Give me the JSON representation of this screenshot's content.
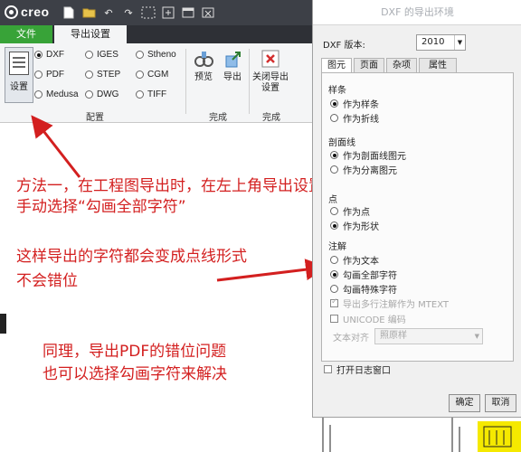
{
  "app": {
    "logo_text": "creo"
  },
  "quick_access": [
    "new-icon",
    "open-icon",
    "undo-icon",
    "redo-icon",
    "select-box-icon",
    "regenerate-icon",
    "window-icon",
    "close-window-icon"
  ],
  "ribbon": {
    "tabs": {
      "file": "文件",
      "export_setup": "导出设置"
    },
    "setup_label": "设置",
    "formats": [
      {
        "label": "DXF",
        "selected": true
      },
      {
        "label": "IGES",
        "selected": false
      },
      {
        "label": "Stheno",
        "selected": false
      },
      {
        "label": "PDF",
        "selected": false
      },
      {
        "label": "STEP",
        "selected": false
      },
      {
        "label": "CGM",
        "selected": false
      },
      {
        "label": "Medusa",
        "selected": false
      },
      {
        "label": "DWG",
        "selected": false
      },
      {
        "label": "TIFF",
        "selected": false
      }
    ],
    "groups": {
      "config": "配置",
      "finish1": "完成",
      "finish2": "完成"
    },
    "preview_label": "预览",
    "export_label": "导出",
    "close_label_1": "关闭导出",
    "close_label_2": "设置"
  },
  "annotations": {
    "line1": "方法一，在工程图导出时，在左上角导出设置",
    "line2": "手动选择“勾画全部字符”",
    "line3": "这样导出的字符都会变成点线形式",
    "line4": "不会错位",
    "line5": "同理，导出PDF的错位问题",
    "line6": "也可以选择勾画字符来解决"
  },
  "dialog": {
    "title": "DXF 的导出环境",
    "version_label": "DXF 版本:",
    "version_value": "2010",
    "tabs": [
      "图元",
      "页面",
      "杂项",
      "属性"
    ],
    "spline": {
      "label": "样条",
      "options": [
        "作为样条",
        "作为折线"
      ],
      "selected": 0
    },
    "hatch": {
      "label": "剖面线",
      "options": [
        "作为剖面线图元",
        "作为分离图元"
      ],
      "selected": 0
    },
    "point": {
      "label": "点",
      "options": [
        "作为点",
        "作为形状"
      ],
      "selected": 1
    },
    "note": {
      "label": "注解",
      "options": [
        "作为文本",
        "勾画全部字符",
        "勾画特殊字符"
      ],
      "selected": 1
    },
    "mtext_label": "导出多行注解作为 MTEXT",
    "unicode_label": "UNICODE 编码",
    "text_align_label": "文本对齐",
    "text_align_value": "照原样",
    "open_log_label": "打开日志窗口",
    "ok_label": "确定",
    "cancel_label": "取消"
  },
  "colors": {
    "accent_green": "#38a338",
    "annotation_red": "#d31f1f"
  }
}
